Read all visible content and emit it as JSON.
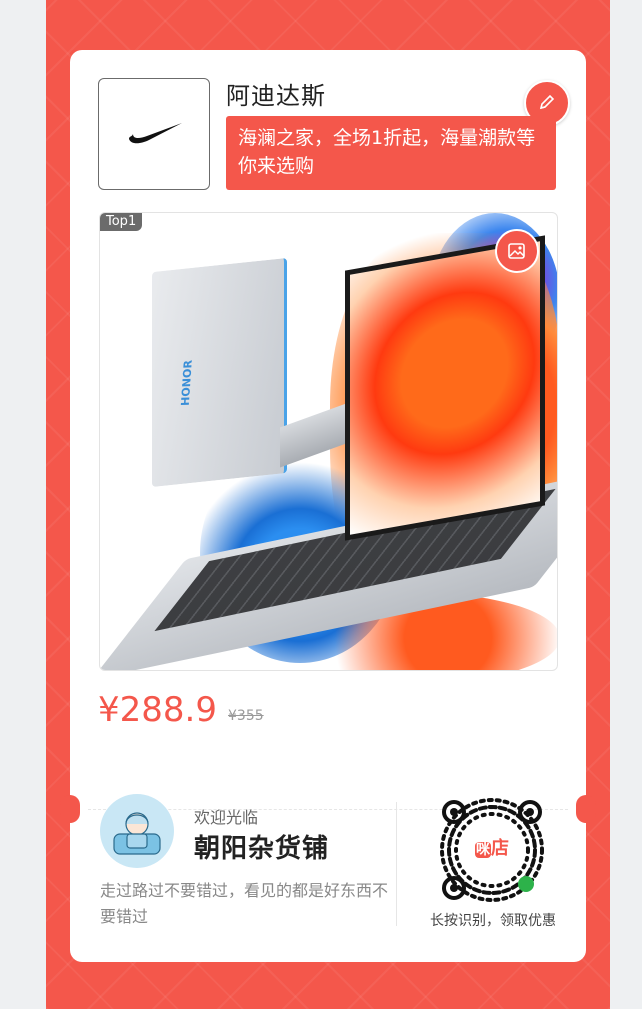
{
  "brand": {
    "name": "阿迪达斯",
    "slogan": "海澜之家，全场1折起，海量潮款等你来选购",
    "logo_icon": "nike-swoosh-icon"
  },
  "product": {
    "rank_badge": "Top1",
    "image_icon": "image-edit-icon",
    "price": "¥288.9",
    "original_price": "¥355"
  },
  "shop": {
    "welcome": "欢迎光临",
    "name": "朝阳杂货铺",
    "description": "走过路过不要错过，看见的都是好东西不要错过",
    "qr_logo_a": "咪",
    "qr_logo_b": "店",
    "qr_tip": "长按识别，领取优惠"
  },
  "colors": {
    "accent": "#f4574b",
    "background": "#ffffff"
  }
}
